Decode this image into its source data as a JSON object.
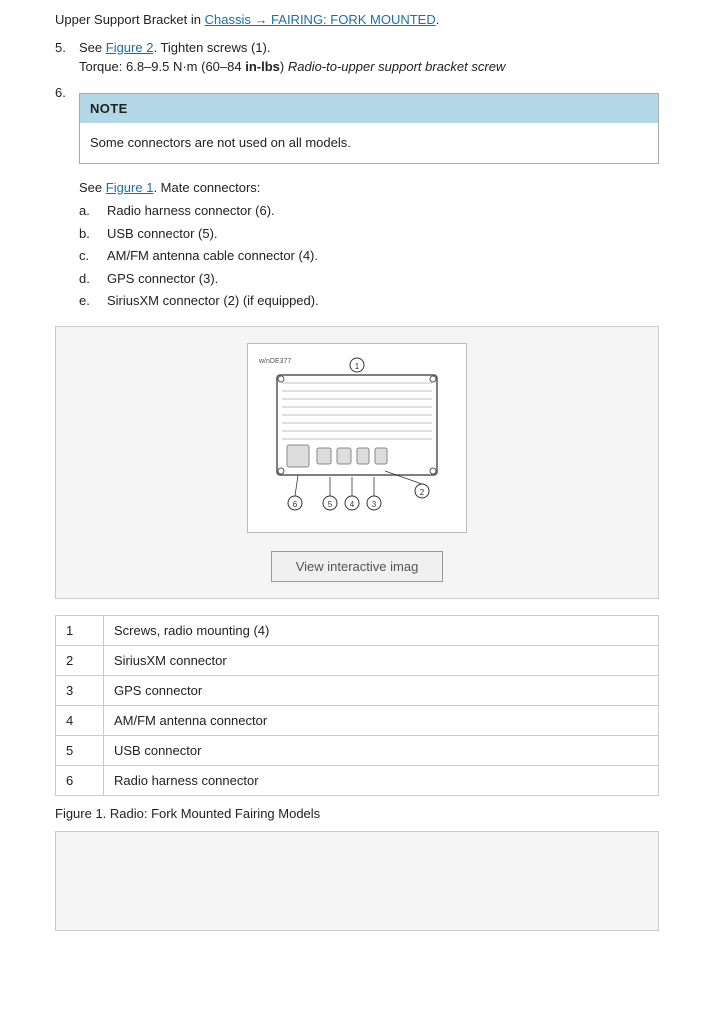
{
  "header": {
    "intro": "Upper Support Bracket in",
    "link1_text": "Chassis → FAIRING: FORK MOUNTED",
    "link1_href": "#"
  },
  "steps": [
    {
      "num": "5.",
      "parts": [
        {
          "text": "See ",
          "link": "Figure 2",
          "after": ". Tighten screws (1)."
        },
        {
          "text": "Torque: 6.8–9.5 N·m (60–84 ",
          "bold": "in-lbs",
          "italic": " Radio-to-upper support bracket screw",
          "after": ""
        }
      ]
    },
    {
      "num": "6.",
      "note": {
        "header": "NOTE",
        "body": "Some connectors are not used on all models."
      },
      "see_text": "See ",
      "see_link": "Figure 1",
      "see_after": ". Mate connectors:",
      "sub_items": [
        {
          "label": "a.",
          "text": "Radio harness connector (6)."
        },
        {
          "label": "b.",
          "text": "USB connector (5)."
        },
        {
          "label": "c.",
          "text": "AM/FM antenna cable connector (4)."
        },
        {
          "label": "d.",
          "text": "GPS connector (3)."
        },
        {
          "label": "e.",
          "text": "SiriusXM connector (2) (if equipped)."
        }
      ]
    }
  ],
  "figure": {
    "label": "w/nDE377",
    "view_btn_label": "View interactive imag",
    "callouts": [
      "1",
      "2",
      "3",
      "4",
      "5",
      "6"
    ]
  },
  "table": {
    "rows": [
      {
        "num": "1",
        "desc": "Screws, radio mounting (4)"
      },
      {
        "num": "2",
        "desc": "SiriusXM connector"
      },
      {
        "num": "3",
        "desc": "GPS connector"
      },
      {
        "num": "4",
        "desc": "AM/FM antenna connector"
      },
      {
        "num": "5",
        "desc": "USB connector"
      },
      {
        "num": "6",
        "desc": "Radio harness connector"
      }
    ]
  },
  "figure_caption": "Figure 1. Radio: Fork Mounted Fairing Models"
}
